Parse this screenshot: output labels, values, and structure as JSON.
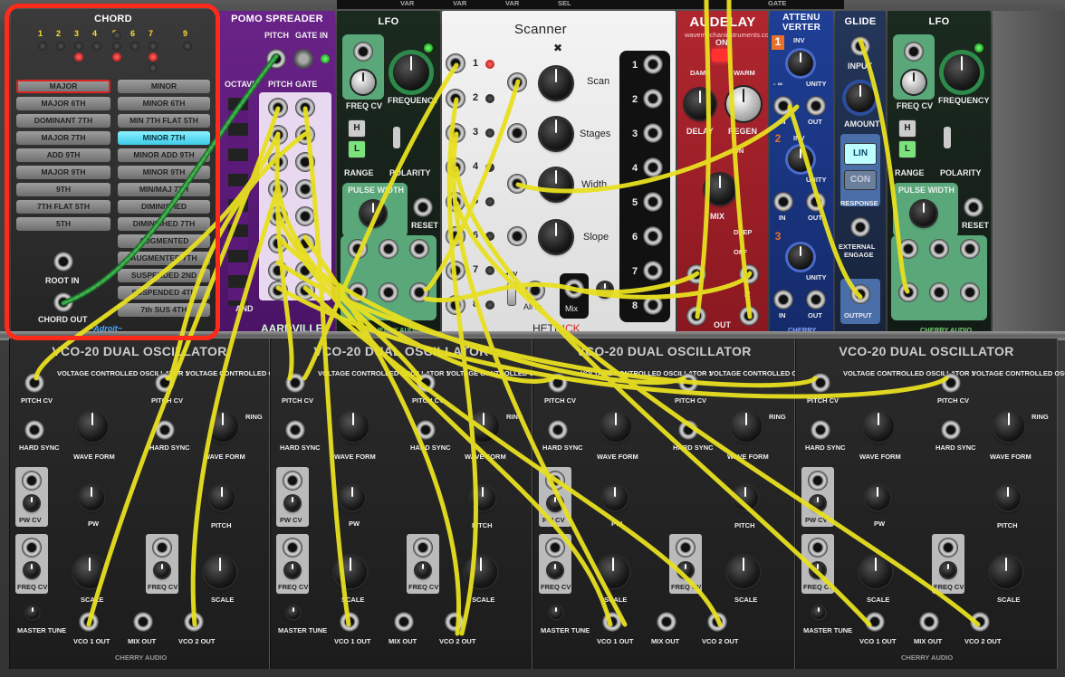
{
  "top_strip": {
    "labels": [
      "VAR",
      "VAR",
      "VAR",
      "SEL",
      "GATE"
    ]
  },
  "chord": {
    "title": "CHORD",
    "tone_numbers": [
      "1",
      "2",
      "3",
      "4",
      "5",
      "6",
      "7",
      "9"
    ],
    "chord_buttons_left": [
      "MAJOR",
      "MAJOR 6TH",
      "DOMINANT 7TH",
      "MAJOR 7TH",
      "ADD 9TH",
      "MAJOR 9TH",
      "9TH",
      "7TH FLAT 5TH",
      "5TH"
    ],
    "chord_buttons_right": [
      "MINOR",
      "MINOR 6TH",
      "MIN 7TH FLAT 5TH",
      "MINOR 7TH",
      "MINOR ADD 9TH",
      "MINOR 9TH",
      "MIN/MAJ 7TH",
      "DIMINISHED",
      "DIMINISHED 7TH",
      "AUGMENTED",
      "AUGMENTED 7TH",
      "SUSPENDED 2ND",
      "SUSPENDED 4TH",
      "7th SUS 4TH"
    ],
    "selected": "MINOR 7TH",
    "root_in": "ROOT IN",
    "chord_out": "CHORD OUT",
    "brand": "~Adroit~"
  },
  "pomo": {
    "title": "POMO SPREADER",
    "pitch": "PITCH",
    "gate": "GATE",
    "in": "IN",
    "octave": "OCTAVE",
    "pitch2": "PITCH",
    "gate2": "GATE",
    "brand": "AARDVILLE",
    "band_label": "AND"
  },
  "lfo1": {
    "title": "LFO",
    "freq_cv": "FREQ CV",
    "frequency": "FREQUENCY",
    "range": "RANGE",
    "polarity": "POLARITY",
    "pulse_width": "PULSE WIDTH",
    "reset": "RESET",
    "brand": "CHERRY AUDIO",
    "h": "H",
    "l": "L"
  },
  "scanner": {
    "title": "Scanner",
    "labels": [
      "Scan",
      "Stages",
      "Width",
      "Slope"
    ],
    "channels": [
      "1",
      "2",
      "3",
      "4",
      "5",
      "6",
      "7",
      "8"
    ],
    "v5": "+5V",
    "all_in": "All In",
    "mix": "Mix",
    "brand_a": "HETR",
    "brand_b": "ICK"
  },
  "audelay": {
    "title": "AUDELAY",
    "url": "wavemechaninstruments.com",
    "on": "ON",
    "damp": "DAMP",
    "warm": "WARM",
    "delay": "DELAY",
    "regen": "REGEN",
    "mix": "MIX",
    "on_off": "ON",
    "deep": "DEEP",
    "off": "OFF",
    "r": "R",
    "out": "OUT"
  },
  "attenuverter": {
    "title1": "ATTENU",
    "title2": "VERTER",
    "inv": "INV",
    "minf": "- ∞",
    "unity": "UNITY",
    "in": "IN",
    "out": "OUT",
    "n1": "1",
    "n2": "2",
    "n3": "3",
    "brand": "CHERRY"
  },
  "glide": {
    "title": "GLIDE",
    "input": "INPUT",
    "amount": "AMOUNT",
    "lin": "LIN",
    "con": "CON",
    "response": "RESPONSE",
    "external": "EXTERNAL",
    "engage": "ENGAGE",
    "output": "OUTPUT"
  },
  "lfo2": {
    "title": "LFO",
    "freq_cv": "FREQ CV",
    "frequency": "FREQUENCY",
    "range": "RANGE",
    "polarity": "POLARITY",
    "pulse_width": "PULSE WIDTH",
    "reset": "RESET",
    "brand": "CHERRY AUDIO",
    "h": "H",
    "l": "L"
  },
  "vco": {
    "title": "VCO-20 DUAL OSCILLATOR",
    "osc1": "VOLTAGE CONTROLLED OSCILLATOR 1",
    "osc2": "VOLTAGE CONTROLLED OSCILLATOR 2",
    "pitch_cv": "PITCH CV",
    "hard_sync": "HARD SYNC",
    "wave_form": "WAVE FORM",
    "ring": "RING",
    "pw_cv": "PW CV",
    "pw": "PW",
    "pitch": "PITCH",
    "freq_cv": "FREQ CV",
    "scale": "SCALE",
    "master_tune": "MASTER TUNE",
    "vco1_out": "VCO 1 OUT",
    "mix_out": "MIX OUT",
    "vco2_out": "VCO 2 OUT",
    "brand": "CHERRY AUDIO",
    "scale_marks": [
      "32'",
      "16'",
      "8'",
      "4'",
      "2'"
    ],
    "pitch_marks": [
      "-5",
      "-4",
      "-3",
      "-2",
      "-1",
      "0",
      "+1",
      "+2",
      "+3",
      "+4",
      "+5"
    ]
  },
  "colors": {
    "cable_yellow": "#e8e020",
    "cable_green": "#2f9a3a",
    "highlight": "#ff2a1a",
    "pomo": "#5b1a7a",
    "lfo": "#17281c",
    "audelay": "#a0202a",
    "atten": "#1b3a8a",
    "glide": "#1d2d47"
  }
}
